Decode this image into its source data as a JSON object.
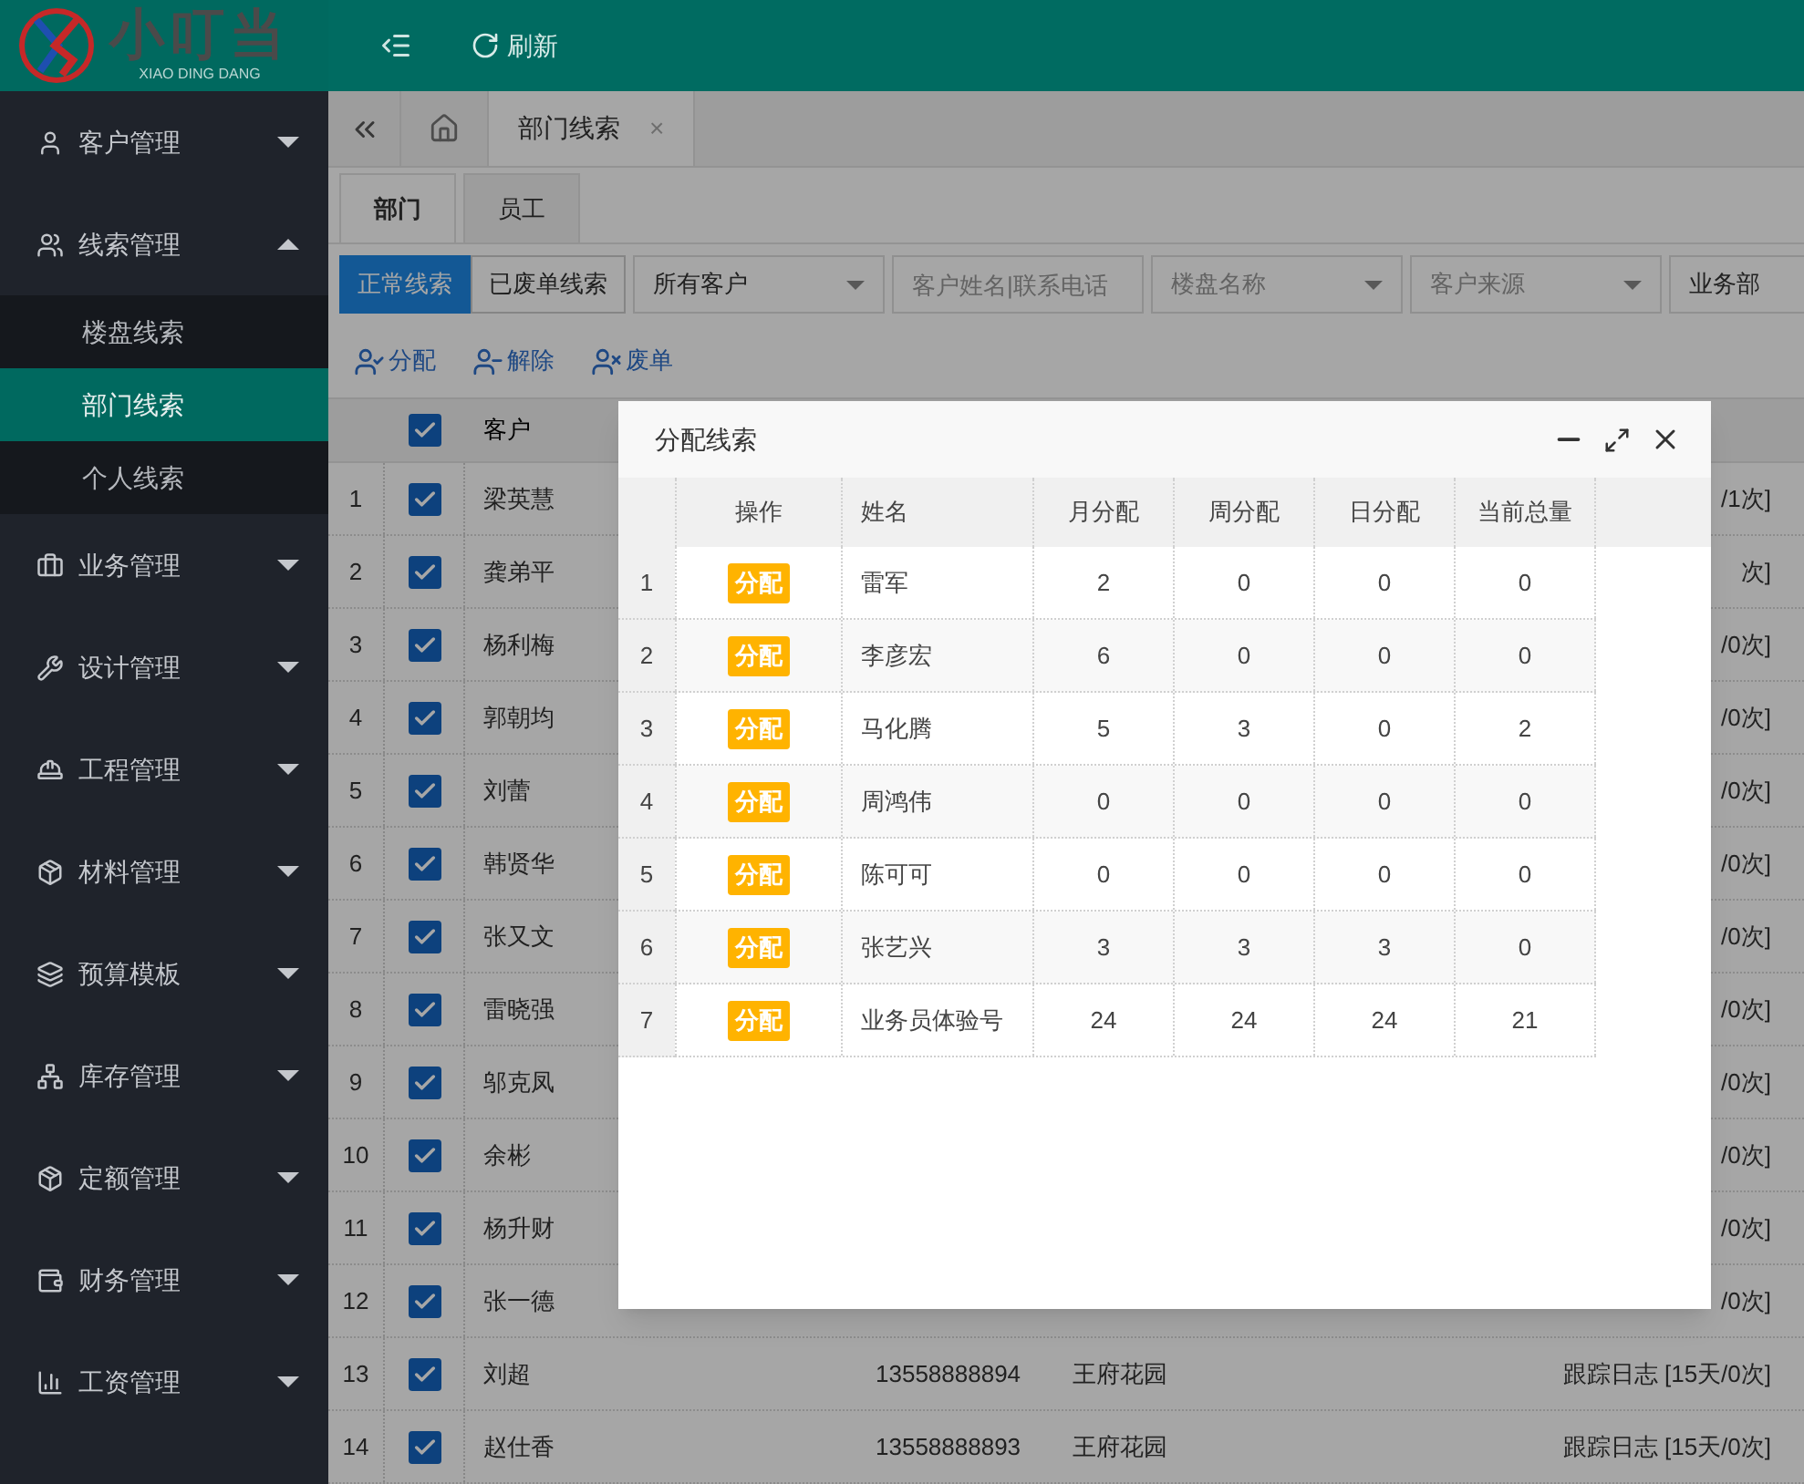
{
  "header": {
    "logo_text": "小叮当",
    "logo_subtitle": "XIAO DING DANG",
    "refresh": "刷新"
  },
  "sidebar": {
    "items": [
      {
        "label": "客户管理",
        "expanded": false
      },
      {
        "label": "线索管理",
        "expanded": true,
        "children": [
          {
            "label": "楼盘线索",
            "selected": false
          },
          {
            "label": "部门线索",
            "selected": true
          },
          {
            "label": "个人线索",
            "selected": false
          }
        ]
      },
      {
        "label": "业务管理",
        "expanded": false
      },
      {
        "label": "设计管理",
        "expanded": false
      },
      {
        "label": "工程管理",
        "expanded": false
      },
      {
        "label": "材料管理",
        "expanded": false
      },
      {
        "label": "预算模板",
        "expanded": false
      },
      {
        "label": "库存管理",
        "expanded": false
      },
      {
        "label": "定额管理",
        "expanded": false
      },
      {
        "label": "财务管理",
        "expanded": false
      },
      {
        "label": "工资管理",
        "expanded": false
      }
    ]
  },
  "page_tabs": [
    {
      "label": "部门线索",
      "selected": true,
      "close": "×"
    }
  ],
  "sub_tabs": [
    {
      "label": "部门",
      "selected": true
    },
    {
      "label": "员工",
      "selected": false
    }
  ],
  "filters": {
    "status_buttons": [
      {
        "label": "正常线索",
        "selected": true
      },
      {
        "label": "已废单线索",
        "selected": false
      }
    ],
    "fields": [
      {
        "kind": "select",
        "value": "所有客户"
      },
      {
        "kind": "input",
        "placeholder": "客户姓名|联系电话"
      },
      {
        "kind": "select",
        "placeholder": "楼盘名称"
      },
      {
        "kind": "select",
        "placeholder": "客户来源"
      },
      {
        "kind": "input",
        "value": "业务部"
      }
    ]
  },
  "actions": [
    {
      "label": "分配"
    },
    {
      "label": "解除"
    },
    {
      "label": "废单"
    }
  ],
  "table": {
    "all_checked": true,
    "columns": [
      "客户"
    ],
    "rows": [
      {
        "index": "1",
        "checked": true,
        "customer": "梁英慧",
        "phone": "",
        "estate": "",
        "log": "/1次]"
      },
      {
        "index": "2",
        "checked": true,
        "customer": "龚弟平",
        "phone": "",
        "estate": "",
        "log": "次]"
      },
      {
        "index": "3",
        "checked": true,
        "customer": "杨利梅",
        "phone": "",
        "estate": "",
        "log": "/0次]"
      },
      {
        "index": "4",
        "checked": true,
        "customer": "郭朝均",
        "phone": "",
        "estate": "",
        "log": "/0次]"
      },
      {
        "index": "5",
        "checked": true,
        "customer": "刘蕾",
        "phone": "",
        "estate": "",
        "log": "/0次]"
      },
      {
        "index": "6",
        "checked": true,
        "customer": "韩贤华",
        "phone": "",
        "estate": "",
        "log": "/0次]"
      },
      {
        "index": "7",
        "checked": true,
        "customer": "张又文",
        "phone": "",
        "estate": "",
        "log": "/0次]"
      },
      {
        "index": "8",
        "checked": true,
        "customer": "雷晓强",
        "phone": "",
        "estate": "",
        "log": "/0次]"
      },
      {
        "index": "9",
        "checked": true,
        "customer": "邬克凤",
        "phone": "",
        "estate": "",
        "log": "/0次]"
      },
      {
        "index": "10",
        "checked": true,
        "customer": "余彬",
        "phone": "",
        "estate": "",
        "log": "/0次]"
      },
      {
        "index": "11",
        "checked": true,
        "customer": "杨升财",
        "phone": "",
        "estate": "",
        "log": "/0次]"
      },
      {
        "index": "12",
        "checked": true,
        "customer": "张一德",
        "phone": "",
        "estate": "",
        "log": "/0次]"
      },
      {
        "index": "13",
        "checked": true,
        "customer": "刘超",
        "phone": "13558888894",
        "estate": "王府花园",
        "log": "跟踪日志 [15天/0次]"
      },
      {
        "index": "14",
        "checked": true,
        "customer": "赵仕香",
        "phone": "13558888893",
        "estate": "王府花园",
        "log": "跟踪日志 [15天/0次]"
      }
    ]
  },
  "dialog": {
    "title": "分配线索",
    "columns": [
      "操作",
      "姓名",
      "月分配",
      "周分配",
      "日分配",
      "当前总量"
    ],
    "rows": [
      {
        "index": "1",
        "action": "分配",
        "name": "雷军",
        "month": "2",
        "week": "0",
        "day": "0",
        "total": "0"
      },
      {
        "index": "2",
        "action": "分配",
        "name": "李彦宏",
        "month": "6",
        "week": "0",
        "day": "0",
        "total": "0"
      },
      {
        "index": "3",
        "action": "分配",
        "name": "马化腾",
        "month": "5",
        "week": "3",
        "day": "0",
        "total": "2"
      },
      {
        "index": "4",
        "action": "分配",
        "name": "周鸿伟",
        "month": "0",
        "week": "0",
        "day": "0",
        "total": "0"
      },
      {
        "index": "5",
        "action": "分配",
        "name": "陈可可",
        "month": "0",
        "week": "0",
        "day": "0",
        "total": "0"
      },
      {
        "index": "6",
        "action": "分配",
        "name": "张艺兴",
        "month": "3",
        "week": "3",
        "day": "3",
        "total": "0"
      },
      {
        "index": "7",
        "action": "分配",
        "name": "业务员体验号",
        "month": "24",
        "week": "24",
        "day": "24",
        "total": "21"
      }
    ]
  }
}
